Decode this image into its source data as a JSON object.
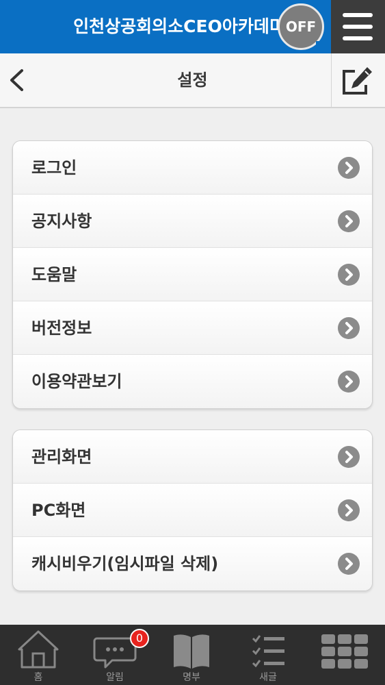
{
  "appbar": {
    "title": "인천상공회의소CEO아카데미",
    "off_badge": "OFF",
    "brand_color": "#0a6fc3"
  },
  "subbar": {
    "title": "설정"
  },
  "menu_group_1": [
    {
      "label": "로그인"
    },
    {
      "label": "공지사항"
    },
    {
      "label": "도움말"
    },
    {
      "label": "버전정보"
    },
    {
      "label": "이용약관보기"
    }
  ],
  "menu_group_2": [
    {
      "label": "관리화면"
    },
    {
      "label": "PC화면"
    },
    {
      "label": "캐시비우기(임시파일 삭제)"
    }
  ],
  "bottom_nav": [
    {
      "label": "홈",
      "icon": "home-icon"
    },
    {
      "label": "알림",
      "icon": "chat-bubble-icon",
      "badge": "0"
    },
    {
      "label": "명부",
      "icon": "book-icon"
    },
    {
      "label": "새글",
      "icon": "checklist-icon"
    },
    {
      "label": "",
      "icon": "grid-menu-icon"
    }
  ]
}
